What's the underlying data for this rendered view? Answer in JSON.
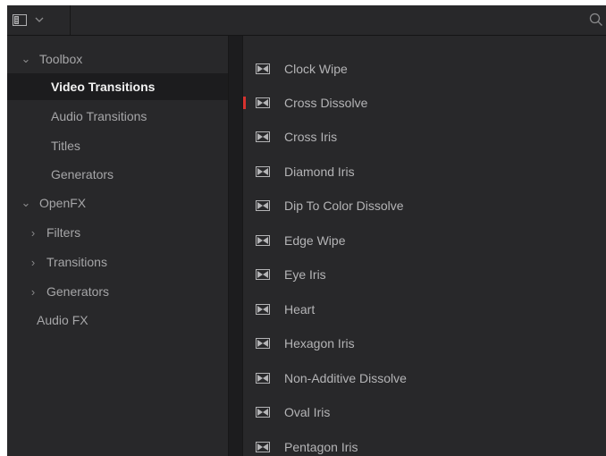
{
  "toolbar": {
    "panel_icon": "sidebar-panel-icon",
    "dropdown_icon": "chevron-down-icon",
    "search_icon": "search-icon"
  },
  "sidebar": {
    "items": [
      {
        "label": "Toolbox",
        "expander": "expanded"
      },
      {
        "label": "Video Transitions",
        "selected": true
      },
      {
        "label": "Audio Transitions"
      },
      {
        "label": "Titles"
      },
      {
        "label": "Generators"
      },
      {
        "label": "OpenFX",
        "expander": "expanded"
      },
      {
        "label": "Filters",
        "expander": "collapsed"
      },
      {
        "label": "Transitions",
        "expander": "collapsed"
      },
      {
        "label": "Generators",
        "expander": "collapsed"
      },
      {
        "label": "Audio FX"
      }
    ]
  },
  "transitions": {
    "items": [
      {
        "label": "Clock Wipe"
      },
      {
        "label": "Cross Dissolve",
        "marked": true
      },
      {
        "label": "Cross Iris"
      },
      {
        "label": "Diamond Iris"
      },
      {
        "label": "Dip To Color Dissolve"
      },
      {
        "label": "Edge Wipe"
      },
      {
        "label": "Eye Iris"
      },
      {
        "label": "Heart"
      },
      {
        "label": "Hexagon Iris"
      },
      {
        "label": "Non-Additive Dissolve"
      },
      {
        "label": "Oval Iris"
      },
      {
        "label": "Pentagon Iris"
      }
    ],
    "item_icon": "transition-icon"
  },
  "colors": {
    "background": "#28282a",
    "selected_row": "#1c1c1e",
    "marker": "#d6322f",
    "text": "#b4b4b6",
    "selected_text": "#f2f2f2"
  }
}
